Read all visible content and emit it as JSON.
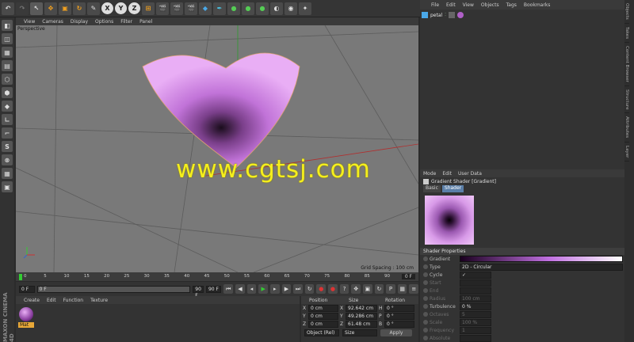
{
  "toolbar": {
    "axis_x": "X",
    "axis_y": "Y",
    "axis_z": "Z"
  },
  "viewport": {
    "menu": [
      "View",
      "Cameras",
      "Display",
      "Options",
      "Filter",
      "Panel"
    ],
    "label": "Perspective",
    "grid_spacing": "Grid Spacing : 100 cm"
  },
  "timeline": {
    "ticks": [
      "0",
      "5",
      "10",
      "15",
      "20",
      "25",
      "30",
      "35",
      "40",
      "45",
      "50",
      "55",
      "60",
      "65",
      "70",
      "75",
      "80",
      "85",
      "90"
    ],
    "end_frame_label": "0 F",
    "start_field": "0 F",
    "current_field": "0 F",
    "max_field": "90 F",
    "end_field": "90 F"
  },
  "material_manager": {
    "menu": [
      "Create",
      "Edit",
      "Function",
      "Texture"
    ],
    "material_name": "Mat"
  },
  "coordinates": {
    "headers": [
      "Position",
      "Size",
      "Rotation"
    ],
    "rows": [
      {
        "axis": "X",
        "pos": "0 cm",
        "size_axis": "X",
        "size": "92.642 cm",
        "rot_axis": "H",
        "rot": "0 °"
      },
      {
        "axis": "Y",
        "pos": "0 cm",
        "size_axis": "Y",
        "size": "49.286 cm",
        "rot_axis": "P",
        "rot": "0 °"
      },
      {
        "axis": "Z",
        "pos": "0 cm",
        "size_axis": "Z",
        "size": "61.48 cm",
        "rot_axis": "B",
        "rot": "0 °"
      }
    ],
    "mode_select": "Object (Rel)",
    "size_select": "Size",
    "apply_label": "Apply"
  },
  "object_manager": {
    "menu": [
      "File",
      "Edit",
      "View",
      "Objects",
      "Tags",
      "Bookmarks"
    ],
    "object_name": "petal"
  },
  "attributes": {
    "header_mode": "Mode",
    "header_edit": "Edit",
    "header_userdata": "User Data",
    "title": "Gradient Shader [Gradient]",
    "tabs": [
      "Basic",
      "Shader"
    ],
    "section": "Shader Properties",
    "props": [
      {
        "label": "Gradient",
        "value": "",
        "dim": false
      },
      {
        "label": "Type",
        "value": "2D - Circular",
        "dim": false
      },
      {
        "label": "Cycle",
        "value": "✓",
        "dim": false
      },
      {
        "label": "Start",
        "value": "",
        "dim": true
      },
      {
        "label": "End",
        "value": "",
        "dim": true
      },
      {
        "label": "Radius",
        "value": "100 cm",
        "dim": true
      },
      {
        "label": "Turbulence",
        "value": "0 %",
        "dim": false
      },
      {
        "label": "Octaves",
        "value": "5",
        "dim": true
      },
      {
        "label": "Scale",
        "value": "100 %",
        "dim": true
      },
      {
        "label": "Frequency",
        "value": "1",
        "dim": true
      },
      {
        "label": "Absolute",
        "value": "",
        "dim": true
      }
    ]
  },
  "side_tabs": [
    "Objects",
    "Takes",
    "Content Browser",
    "Structure",
    "Attributes",
    "Layer"
  ],
  "brand": "MAXON CINEMA 4D",
  "watermark": "www.cgtsj.com",
  "colors": {
    "accent": "#d58de8",
    "watermark": "#f5ef1c",
    "viewport_bg": "#797979"
  }
}
